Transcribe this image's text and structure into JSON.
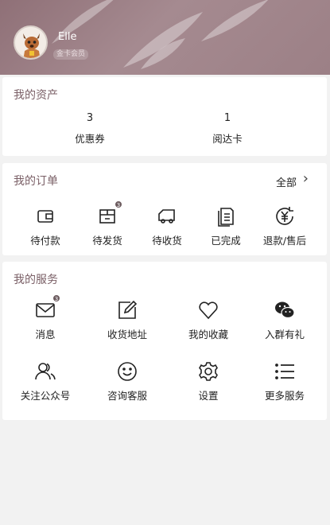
{
  "profile": {
    "name": "Elle",
    "level": "金卡会员",
    "avatar_icon": "deer-avatar-icon"
  },
  "assets": {
    "title": "我的资产",
    "items": [
      {
        "value": "3",
        "label": "优惠券"
      },
      {
        "value": "1",
        "label": "阅达卡"
      }
    ]
  },
  "orders": {
    "title": "我的订单",
    "all_label": "全部",
    "chevron": "›",
    "items": [
      {
        "label": "待付款",
        "icon": "wallet-icon",
        "badge": ""
      },
      {
        "label": "待发货",
        "icon": "package-icon",
        "badge": "3"
      },
      {
        "label": "待收货",
        "icon": "truck-icon",
        "badge": ""
      },
      {
        "label": "已完成",
        "icon": "document-icon",
        "badge": ""
      },
      {
        "label": "退款/售后",
        "icon": "refund-icon",
        "badge": ""
      }
    ]
  },
  "services": {
    "title": "我的服务",
    "items": [
      {
        "label": "消息",
        "icon": "mail-icon",
        "badge": "3"
      },
      {
        "label": "收货地址",
        "icon": "edit-icon",
        "badge": ""
      },
      {
        "label": "我的收藏",
        "icon": "heart-icon",
        "badge": ""
      },
      {
        "label": "入群有礼",
        "icon": "wechat-icon",
        "badge": ""
      },
      {
        "label": "关注公众号",
        "icon": "users-icon",
        "badge": ""
      },
      {
        "label": "咨询客服",
        "icon": "smile-icon",
        "badge": ""
      },
      {
        "label": "设置",
        "icon": "gear-icon",
        "badge": ""
      },
      {
        "label": "更多服务",
        "icon": "list-icon",
        "badge": ""
      }
    ]
  },
  "colors": {
    "header": "#9c8086",
    "title": "#7a5f66",
    "badge": "#6b5a5e",
    "background": "#f2f2f2"
  }
}
